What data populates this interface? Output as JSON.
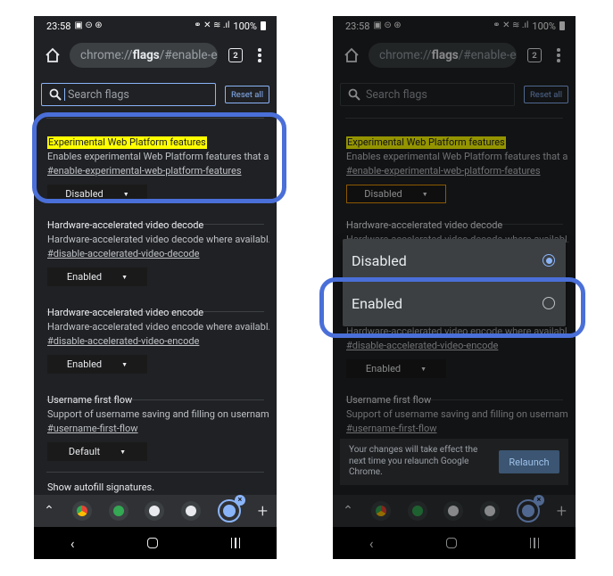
{
  "status": {
    "time": "23:58",
    "battery": "100%"
  },
  "url": {
    "host": "chrome://",
    "bold": "flags",
    "fragment": "/#enable-exp"
  },
  "tab_count": "2",
  "search": {
    "placeholder": "Search flags",
    "reset_label": "Reset all"
  },
  "flags": [
    {
      "title": "Experimental Web Platform features",
      "desc": "Enables experimental Web Platform features that a...",
      "link": "#enable-experimental-web-platform-features",
      "value": "Disabled"
    },
    {
      "title": "Hardware-accelerated video decode",
      "desc": "Hardware-accelerated video decode where availabl...",
      "link": "#disable-accelerated-video-decode",
      "value": "Enabled"
    },
    {
      "title": "Hardware-accelerated video encode",
      "desc": "Hardware-accelerated video encode where availabl...",
      "link": "#disable-accelerated-video-encode",
      "value": "Enabled"
    },
    {
      "title": "Username first flow",
      "desc": "Support of username saving and filling on usernam...",
      "link": "#username-first-flow",
      "value": "Default"
    },
    {
      "title": "Show autofill signatures."
    }
  ],
  "right_flags": [
    {
      "link": "#username-first-flow"
    }
  ],
  "dropdown": {
    "options": [
      "Disabled",
      "Enabled"
    ],
    "selected": "Disabled"
  },
  "snackbar": {
    "message": "Your changes will take effect the next time you relaunch Google Chrome.",
    "button": "Relaunch"
  },
  "colors": {
    "highlight_ring": "#4a6fd8",
    "accent": "#8ab4f8",
    "flag_highlight": "#ffff00"
  },
  "icons": [
    "home-icon",
    "search-icon",
    "tab-switcher-icon",
    "menu-icon",
    "chevron-up-icon",
    "close-icon",
    "plus-icon",
    "back-icon",
    "home-nav-icon",
    "recents-icon"
  ]
}
